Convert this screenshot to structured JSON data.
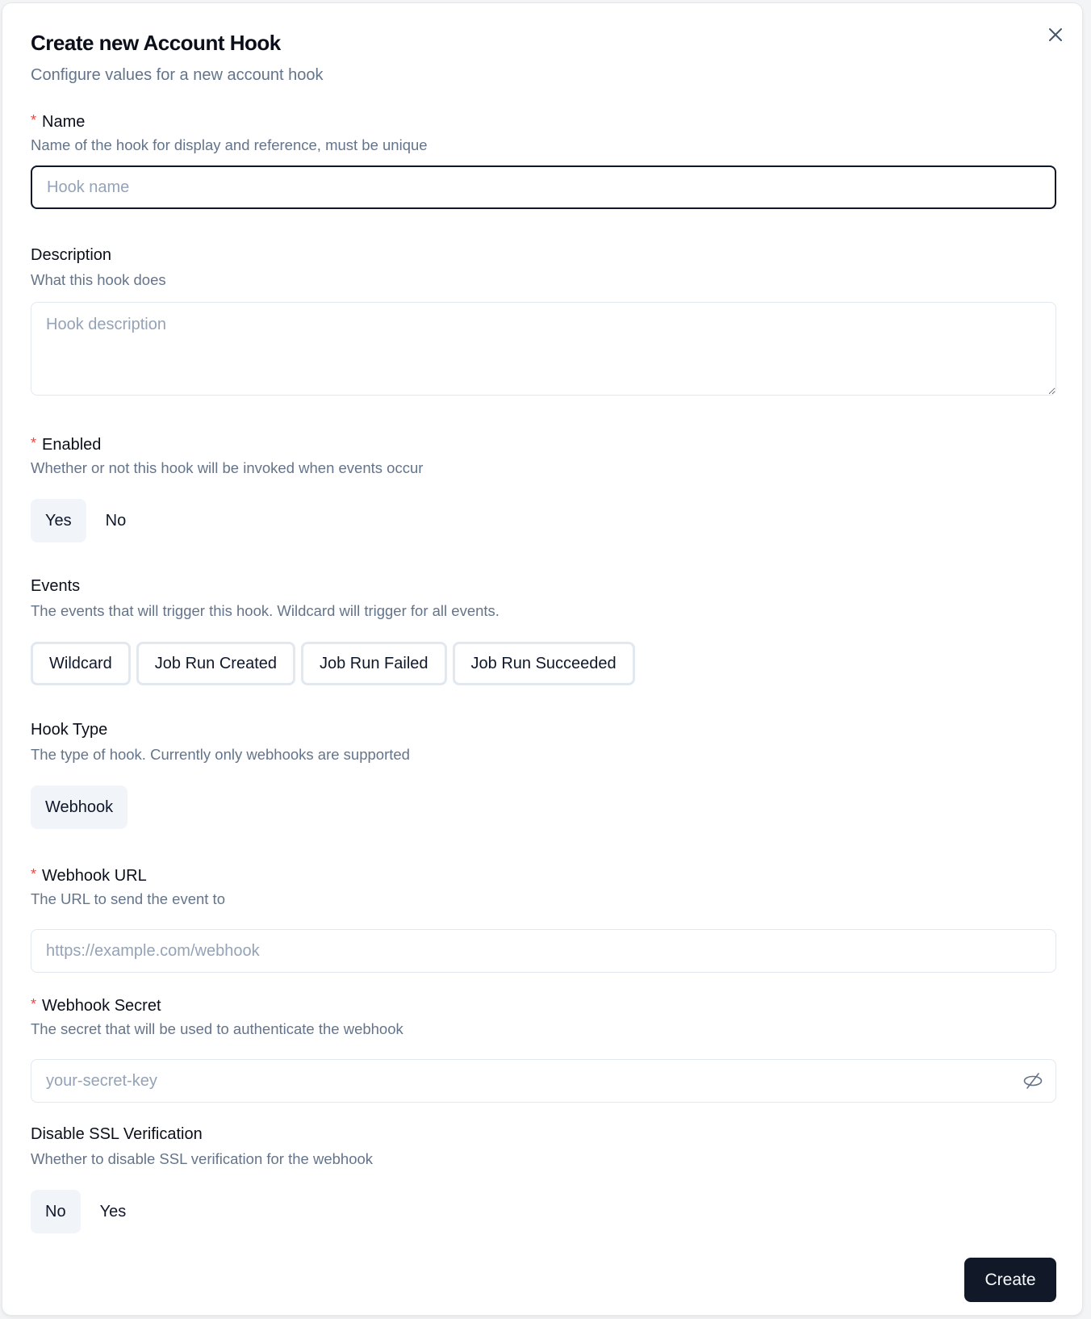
{
  "dialog": {
    "title": "Create new Account Hook",
    "subtitle": "Configure values for a new account hook",
    "close_icon": "x-icon"
  },
  "fields": {
    "name": {
      "required": true,
      "label": "Name",
      "help": "Name of the hook for display and reference, must be unique",
      "value": "",
      "placeholder": "Hook name"
    },
    "description": {
      "required": false,
      "label": "Description",
      "help": "What this hook does",
      "value": "",
      "placeholder": "Hook description"
    },
    "enabled": {
      "required": true,
      "label": "Enabled",
      "help": "Whether or not this hook will be invoked when events occur",
      "options": [
        "Yes",
        "No"
      ],
      "selected": "Yes"
    },
    "events": {
      "required": false,
      "label": "Events",
      "help": "The events that will trigger this hook. Wildcard will trigger for all events.",
      "options": [
        "Wildcard",
        "Job Run Created",
        "Job Run Failed",
        "Job Run Succeeded"
      ]
    },
    "hook_type": {
      "required": false,
      "label": "Hook Type",
      "help": "The type of hook. Currently only webhooks are supported",
      "options": [
        "Webhook"
      ],
      "selected": "Webhook"
    },
    "webhook_url": {
      "required": true,
      "label": "Webhook URL",
      "help": "The URL to send the event to",
      "value": "",
      "placeholder": "https://example.com/webhook"
    },
    "webhook_secret": {
      "required": true,
      "label": "Webhook Secret",
      "help": "The secret that will be used to authenticate the webhook",
      "value": "",
      "placeholder": "your-secret-key",
      "visibility_icon": "eye-off-icon"
    },
    "disable_ssl": {
      "required": false,
      "label": "Disable SSL Verification",
      "help": "Whether to disable SSL verification for the webhook",
      "options": [
        "No",
        "Yes"
      ],
      "selected": "No"
    }
  },
  "footer": {
    "create_label": "Create"
  },
  "colors": {
    "required_asterisk": "#ef4444",
    "primary_button": "#111827",
    "muted_text": "#64748b",
    "selected_segment": "#f1f5f9"
  }
}
